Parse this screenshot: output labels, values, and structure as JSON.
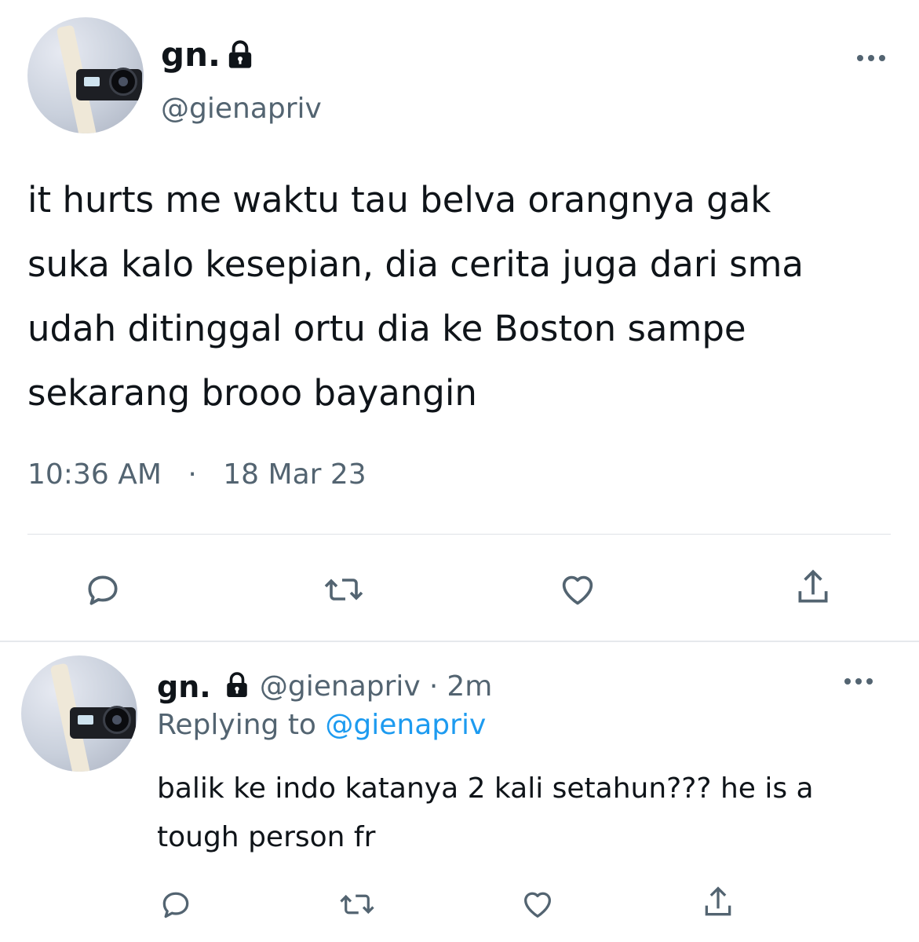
{
  "main_tweet": {
    "display_name": "gn.",
    "handle": "@gienapriv",
    "text_lines": [
      "it hurts me waktu tau belva orangnya gak",
      "suka kalo kesepian, dia cerita juga dari sma",
      "udah ditinggal ortu dia ke Boston sampe",
      "sekarang brooo bayangin"
    ],
    "time": "10:36 AM",
    "separator": "·",
    "date": "18 Mar 23"
  },
  "reply_tweet": {
    "display_name": "gn.",
    "handle": "@gienapriv",
    "separator": "·",
    "age": "2m",
    "replying_prefix": "Replying to",
    "replying_handle": "@gienapriv",
    "text_lines": [
      "balik ke indo katanya 2 kali setahun??? he is a",
      "tough person fr"
    ]
  },
  "icons": {
    "lock": "lock-icon",
    "more": "more-horizontal-icon",
    "reply": "reply-icon",
    "retweet": "retweet-icon",
    "like": "heart-icon",
    "share": "share-icon"
  },
  "colors": {
    "text": "#0f1419",
    "secondary": "#536471",
    "link": "#1d9bf0",
    "divider": "#dfe3e7"
  }
}
